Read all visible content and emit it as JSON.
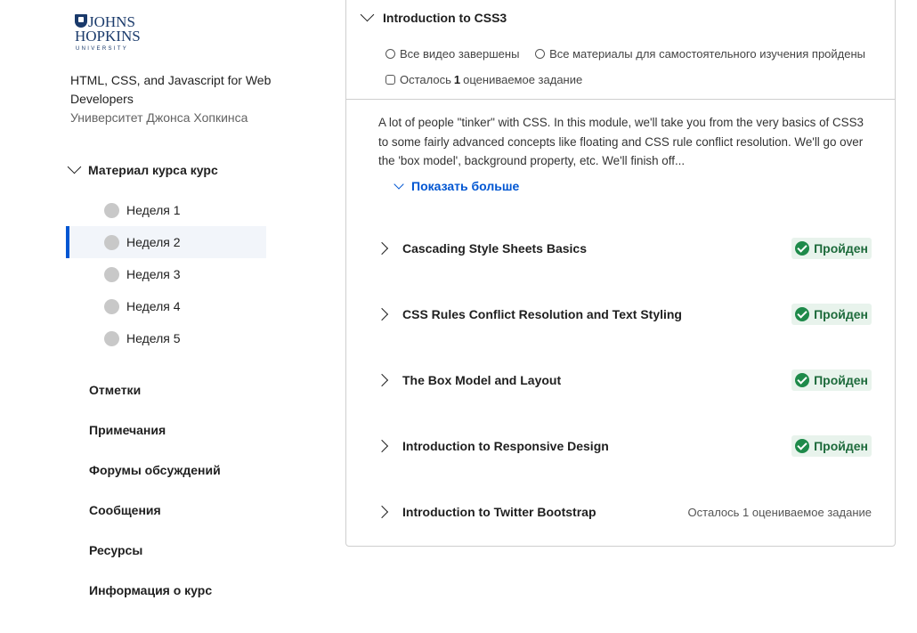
{
  "logo": {
    "line1": "JOHNS",
    "line2": "HOPKINS",
    "line3": "UNIVERSITY"
  },
  "course": {
    "title": "HTML, CSS, and Javascript for Web Developers",
    "university": "Университет Джонса Хопкинса"
  },
  "sidebar": {
    "material_label": "Материал курса курс",
    "weeks": [
      {
        "label": "Неделя 1"
      },
      {
        "label": "Неделя 2"
      },
      {
        "label": "Неделя 3"
      },
      {
        "label": "Неделя 4"
      },
      {
        "label": "Неделя 5"
      }
    ],
    "active_week": "Неделя 2",
    "nav": [
      {
        "label": "Отметки"
      },
      {
        "label": "Примечания"
      },
      {
        "label": "Форумы обсуждений"
      },
      {
        "label": "Сообщения"
      },
      {
        "label": "Ресурсы"
      },
      {
        "label": "Информация о курс"
      }
    ]
  },
  "module": {
    "title": "Introduction to CSS3",
    "stats": {
      "videos": "Все видео завершены",
      "readings": "Все материалы для самостоятельного изучения пройдены",
      "remaining_prefix": "Осталось",
      "remaining_count": "1",
      "remaining_suffix": "оцениваемое задание"
    },
    "description": "A lot of people \"tinker\" with CSS. In this module, we'll take you from the very basics of CSS3 to some fairly advanced concepts like floating and CSS rule conflict resolution. We'll go over the 'box model', background property, etc. We'll finish off...",
    "show_more": "Показать больше",
    "lessons": [
      {
        "title": "Cascading Style Sheets Basics",
        "status": "Пройден"
      },
      {
        "title": "CSS Rules Conflict Resolution and Text Styling",
        "status": "Пройден"
      },
      {
        "title": "The Box Model and Layout",
        "status": "Пройден"
      },
      {
        "title": "Introduction to Responsive Design",
        "status": "Пройден"
      },
      {
        "title": "Introduction to Twitter Bootstrap",
        "remaining": "Осталось 1 оцениваемое задание"
      }
    ]
  },
  "colors": {
    "accent": "#0056d2",
    "success": "#1e8a4a",
    "success_bg": "#e8f3ec",
    "brand": "#1a3a6b"
  },
  "icons": [
    "shield-logo-icon",
    "chevron-down-icon",
    "chevron-right-icon",
    "play-circle-icon",
    "reading-icon",
    "assignment-icon",
    "check-circle-icon",
    "week-status-icon"
  ]
}
